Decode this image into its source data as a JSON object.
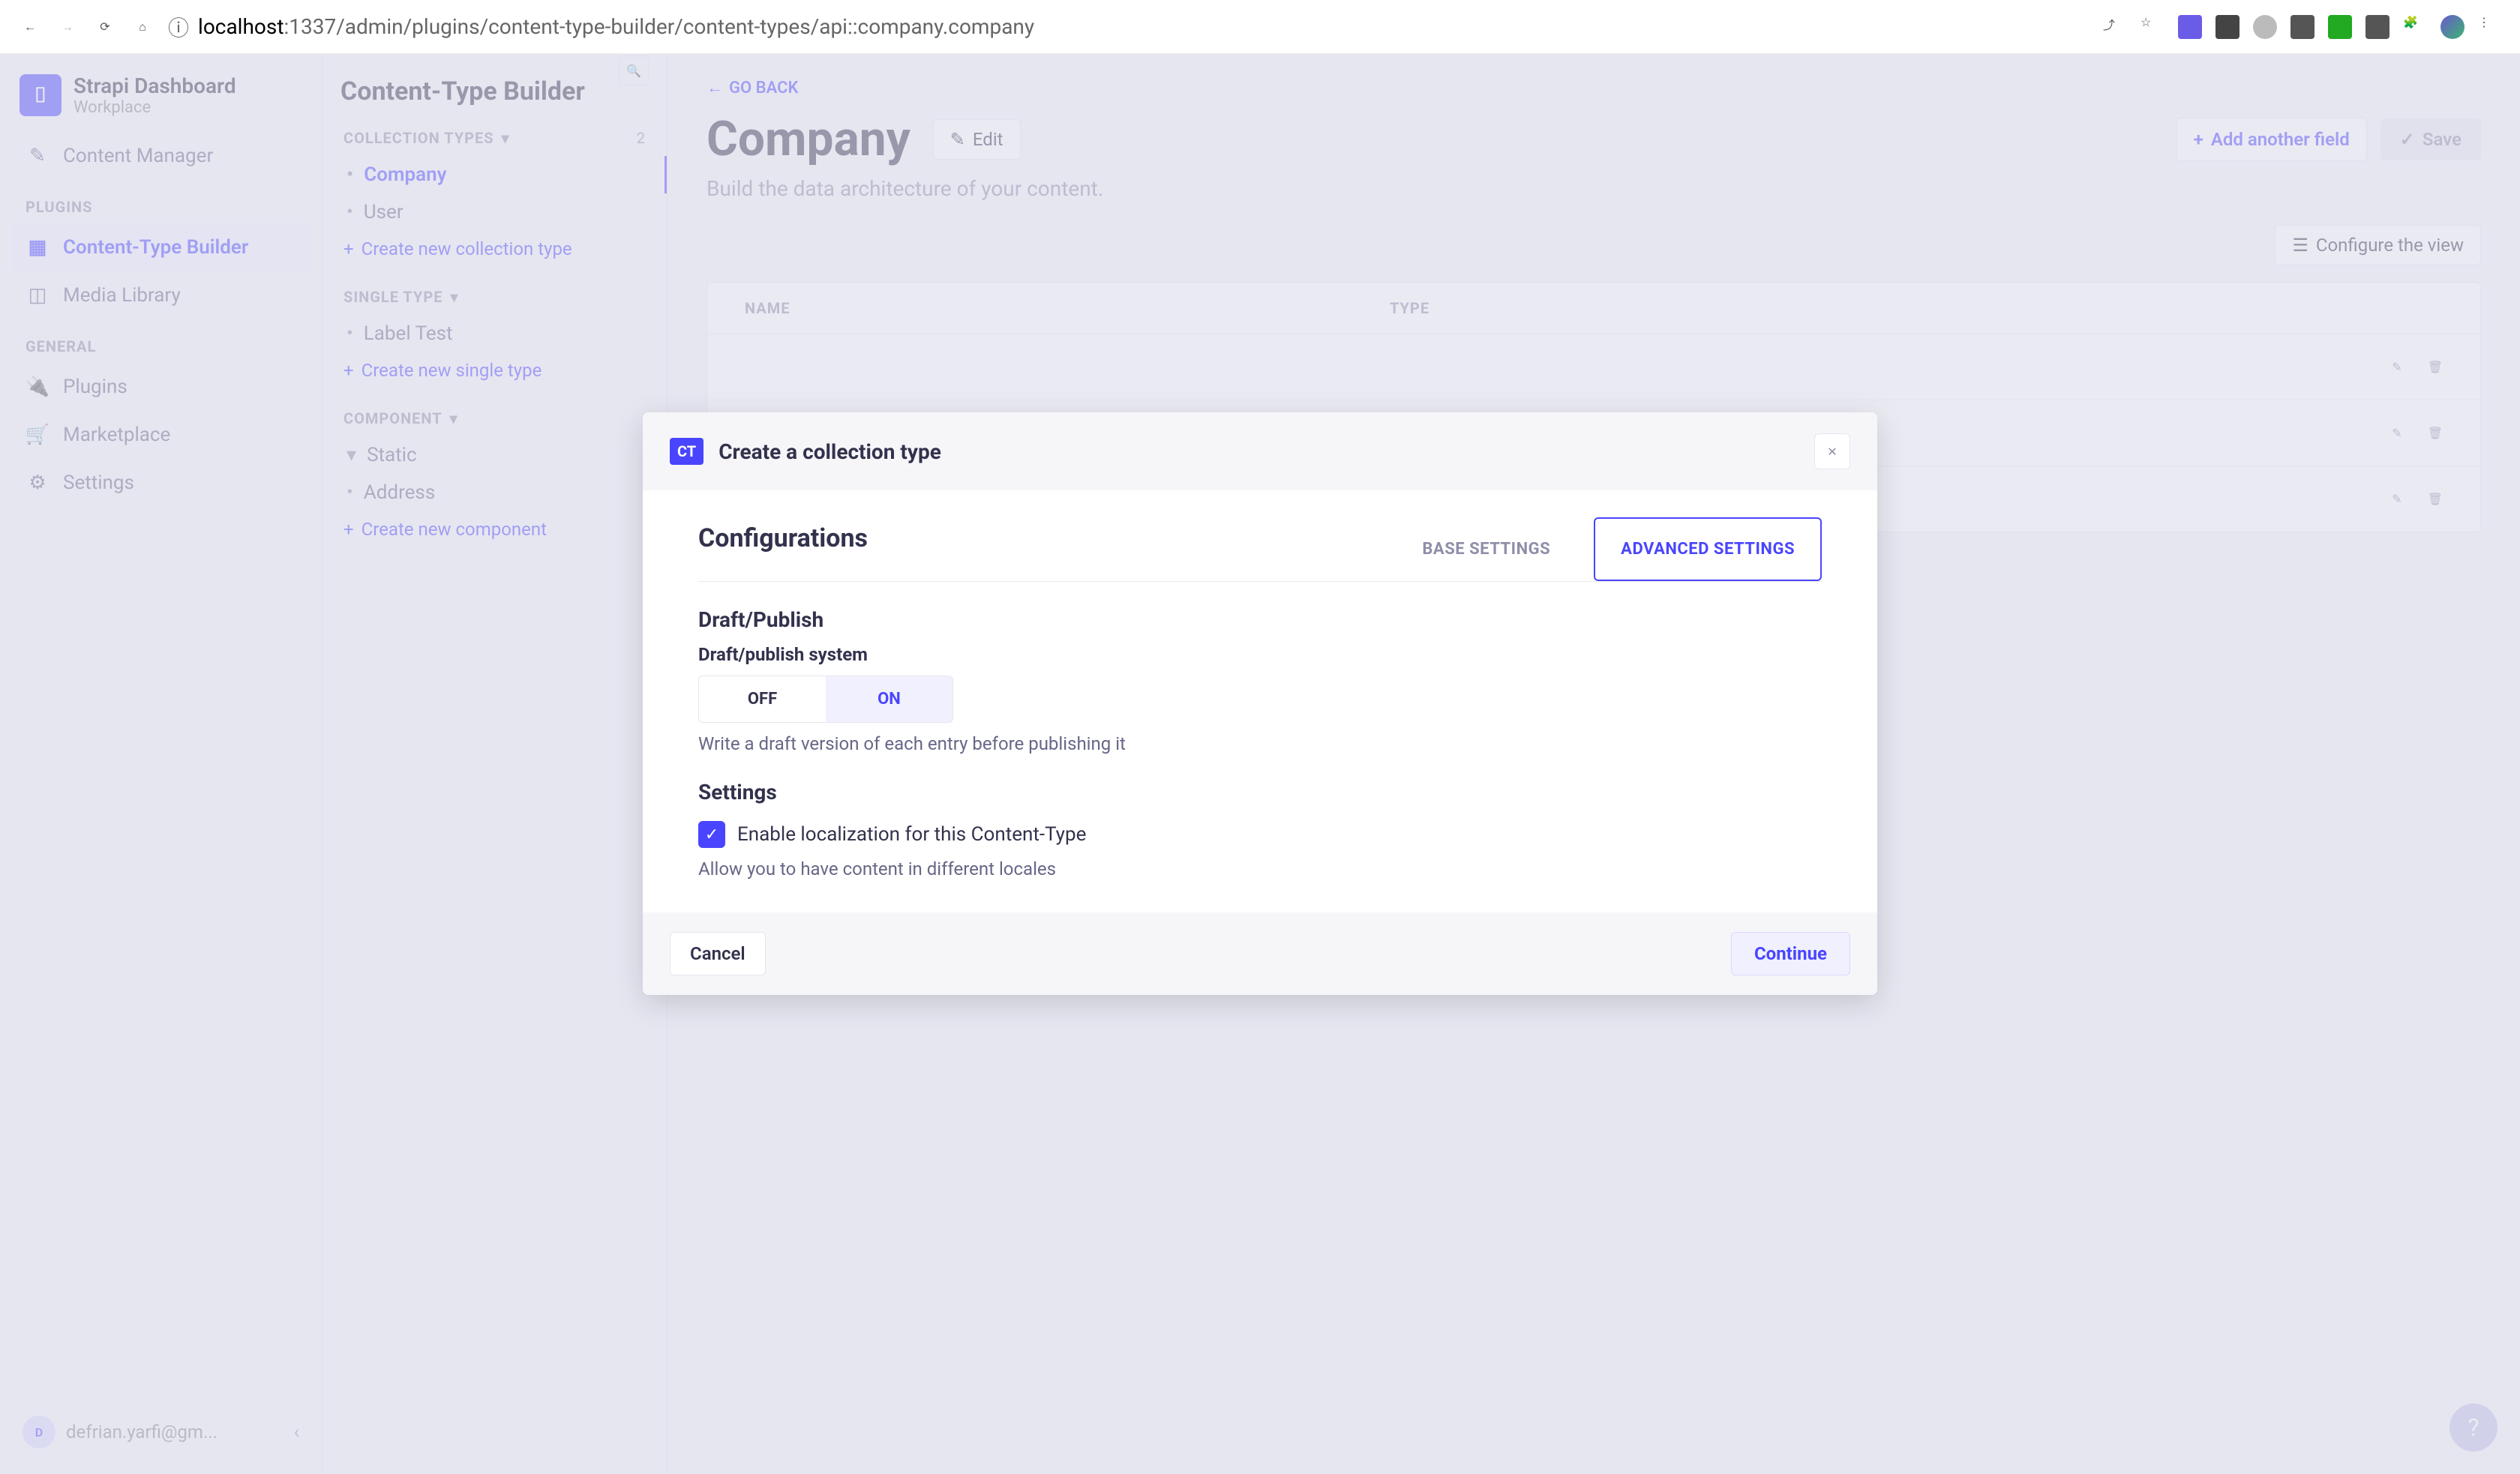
{
  "browser": {
    "url_host": "localhost",
    "url_rest": ":1337/admin/plugins/content-type-builder/content-types/api::company.company"
  },
  "brand": {
    "title": "Strapi Dashboard",
    "subtitle": "Workplace",
    "logo": "⌷"
  },
  "nav1": {
    "content_manager": "Content Manager",
    "group_plugins": "PLUGINS",
    "ctb": "Content-Type Builder",
    "media": "Media Library",
    "group_general": "GENERAL",
    "plugins": "Plugins",
    "marketplace": "Marketplace",
    "settings": "Settings",
    "user_initial": "D",
    "user_email": "defrian.yarfi@gm..."
  },
  "nav2": {
    "title": "Content-Type Builder",
    "collection_label": "COLLECTION TYPES",
    "collection_count": "2",
    "items_coll": [
      "Company",
      "User"
    ],
    "add_coll": "Create new collection type",
    "single_label": "SINGLE TYPE",
    "items_single": [
      "Label Test"
    ],
    "add_single": "Create new single type",
    "component_label": "COMPONENT",
    "items_comp": [
      "Static",
      "Address"
    ],
    "add_comp": "Create new component"
  },
  "main": {
    "goback": "GO BACK",
    "title": "Company",
    "edit": "Edit",
    "add_field": "Add another field",
    "save": "Save",
    "subtitle": "Build the data architecture of your content.",
    "configure": "Configure the view",
    "th_name": "NAME",
    "th_type": "TYPE"
  },
  "modal": {
    "badge": "CT",
    "title": "Create a collection type",
    "config": "Configurations",
    "tab_base": "BASE SETTINGS",
    "tab_adv": "ADVANCED SETTINGS",
    "draft_h": "Draft/Publish",
    "draft_lbl": "Draft/publish system",
    "off": "OFF",
    "on": "ON",
    "draft_hint": "Write a draft version of each entry before publishing it",
    "settings_h": "Settings",
    "loc_lbl": "Enable localization for this Content-Type",
    "loc_hint": "Allow you to have content in different locales",
    "cancel": "Cancel",
    "continue": "Continue"
  }
}
